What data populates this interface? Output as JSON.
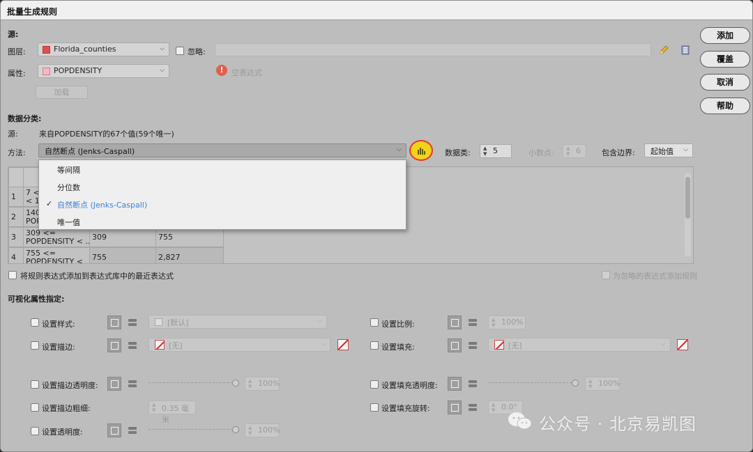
{
  "window": {
    "title": "批量生成规则"
  },
  "source": {
    "section_label": "源:",
    "layer_label": "图层:",
    "layer_value": "Florida_counties",
    "ignore_label": "忽略:",
    "attr_label": "属性:",
    "attr_value": "POPDENSITY",
    "empty_expr": "空表达式",
    "add_button": "加载"
  },
  "classification": {
    "section_label": "数据分类:",
    "source_label": "源:",
    "source_desc": "来自POPDENSITY的67个值(59个唯一)",
    "method_label": "方法:",
    "method_value": "自然断点 (Jenks-Caspall)",
    "classes_label": "数据类:",
    "classes_value": "5",
    "decimals_label": "小数点:",
    "decimals_value": "6",
    "boundary_label": "包含边界:",
    "boundary_value": "起始值",
    "method_options": [
      "等间隔",
      "分位数",
      "自然断点 (Jenks-Caspall)",
      "唯一值"
    ],
    "selected_index": 2
  },
  "table": {
    "rows": [
      {
        "num": "1",
        "expr": "7 <=\n< 14",
        "from": "",
        "to": ""
      },
      {
        "num": "2",
        "expr": "140\nPOPI",
        "from": "",
        "to": ""
      },
      {
        "num": "3",
        "expr": "309 <=\nPOPDENSITY < ...",
        "from": "309",
        "to": "755"
      },
      {
        "num": "4",
        "expr": "755 <=\nPOPDENSITY <",
        "from": "755",
        "to": "2,827"
      }
    ]
  },
  "options": {
    "add_to_recent": "将规则表达式添加到表达式库中的最近表达式",
    "add_to_ignored": "为忽略的表达式添加规则"
  },
  "visual": {
    "section_label": "可视化属性指定:",
    "set_style": "设置样式:",
    "style_value": "[默认]",
    "set_scale": "设置比例:",
    "scale_value": "100%",
    "set_stroke": "设置描边:",
    "stroke_value": "[无]",
    "set_fill": "设置填充:",
    "fill_value": "[无]",
    "set_stroke_opacity": "设置描边透明度:",
    "stroke_opacity_value": "100%",
    "set_fill_opacity": "设置填充透明度:",
    "fill_opacity_value": "100%",
    "set_stroke_width": "设置描边粗细:",
    "stroke_width_value": "0.35 毫米",
    "set_fill_rotation": "设置填充旋转:",
    "fill_rotation_value": "0.0°",
    "set_opacity": "设置透明度:",
    "opacity_value": "100%"
  },
  "buttons": {
    "add": "添加",
    "overwrite": "覆盖",
    "cancel": "取消",
    "help": "帮助"
  },
  "watermark": "公众号 · 北京易凯图",
  "colors": {
    "highlight_ring": "#e23b2a",
    "highlight_fill": "#f2d21b",
    "selected_item": "#3a7fd5"
  }
}
